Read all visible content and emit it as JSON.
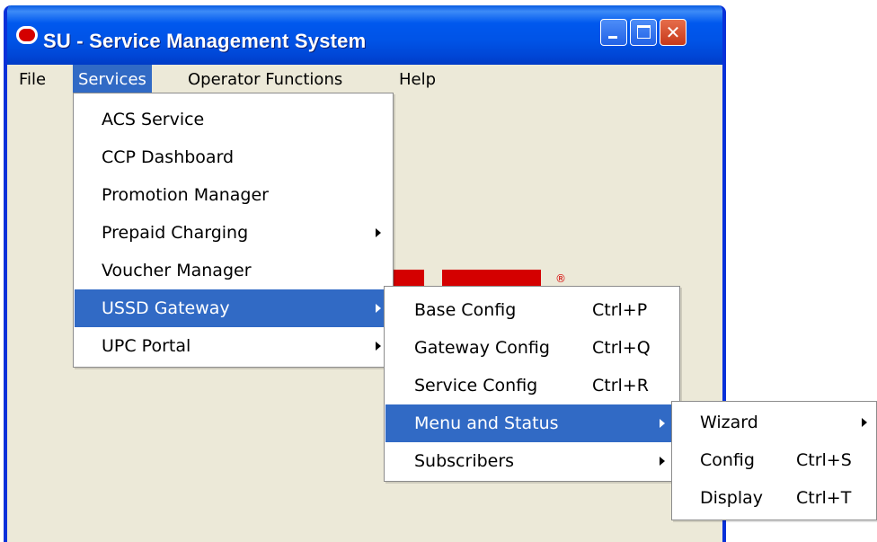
{
  "window": {
    "title": "SU - Service Management System"
  },
  "titlebar_buttons": {
    "close_glyph": "✕"
  },
  "menubar": {
    "items": [
      "File",
      "Services",
      "Operator Functions",
      "Help"
    ],
    "active": "Services"
  },
  "services_menu": {
    "items": [
      {
        "label": "ACS Service"
      },
      {
        "label": "CCP Dashboard"
      },
      {
        "label": "Promotion Manager"
      },
      {
        "label": "Prepaid Charging",
        "submenu": true
      },
      {
        "label": "Voucher Manager"
      },
      {
        "label": "USSD Gateway",
        "submenu": true,
        "highlighted": true
      },
      {
        "label": "UPC Portal",
        "submenu": true
      }
    ]
  },
  "ussd_menu": {
    "items": [
      {
        "label": "Base Config",
        "shortcut": "Ctrl+P"
      },
      {
        "label": "Gateway Config",
        "shortcut": "Ctrl+Q"
      },
      {
        "label": "Service Config",
        "shortcut": "Ctrl+R"
      },
      {
        "label": "Menu and Status",
        "submenu": true,
        "highlighted": true
      },
      {
        "label": "Subscribers",
        "submenu": true
      }
    ]
  },
  "menu_status_menu": {
    "items": [
      {
        "label": "Wizard",
        "submenu": true
      },
      {
        "label": "Config",
        "shortcut": "Ctrl+S"
      },
      {
        "label": "Display",
        "shortcut": "Ctrl+T"
      }
    ]
  },
  "background": {
    "logo_mark": "®"
  },
  "colors": {
    "highlight": "#316ac5",
    "titlebar": "#0058ee",
    "brand_red": "#d40000"
  }
}
